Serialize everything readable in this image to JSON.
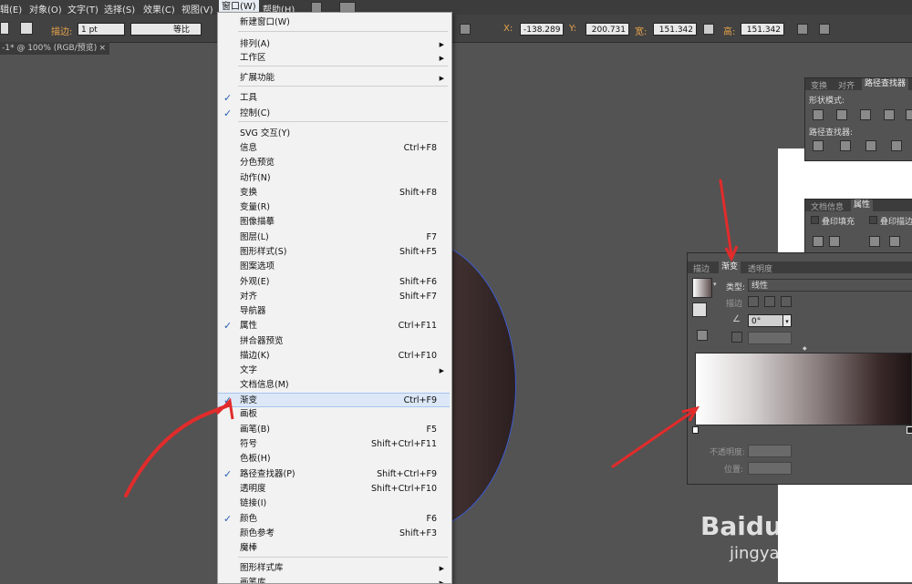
{
  "menubar": {
    "items": [
      "辑(E)",
      "对象(O)",
      "文字(T)",
      "选择(S)",
      "效果(C)",
      "视图(V)",
      "窗口(W)",
      "帮助(H)"
    ]
  },
  "controlbar": {
    "stroke_label": "描边:",
    "stroke_value": "1 pt",
    "profile_label": "等比",
    "x_label": "X:",
    "x_value": "-138.289",
    "y_label": "Y:",
    "y_value": "200.731",
    "w_label": "宽:",
    "w_value": "151.342",
    "h_label": "高:",
    "h_value": "151.342"
  },
  "doc_tab": {
    "title": "-1* @ 100% (RGB/预览)",
    "close": "×"
  },
  "window_menu": {
    "items": [
      {
        "label": "新建窗口(W)",
        "shortcut": "",
        "checked": false,
        "sub": false
      },
      {
        "label": "排列(A)",
        "shortcut": "",
        "checked": false,
        "sub": true
      },
      {
        "label": "工作区",
        "shortcut": "",
        "checked": false,
        "sub": true
      },
      {
        "label": "扩展功能",
        "shortcut": "",
        "checked": false,
        "sub": true
      },
      {
        "label": "工具",
        "shortcut": "",
        "checked": true,
        "sub": false
      },
      {
        "label": "控制(C)",
        "shortcut": "",
        "checked": true,
        "sub": false
      },
      {
        "label": "SVG 交互(Y)",
        "shortcut": "",
        "checked": false,
        "sub": false
      },
      {
        "label": "信息",
        "shortcut": "Ctrl+F8",
        "checked": false,
        "sub": false
      },
      {
        "label": "分色预览",
        "shortcut": "",
        "checked": false,
        "sub": false
      },
      {
        "label": "动作(N)",
        "shortcut": "",
        "checked": false,
        "sub": false
      },
      {
        "label": "变换",
        "shortcut": "Shift+F8",
        "checked": false,
        "sub": false
      },
      {
        "label": "变量(R)",
        "shortcut": "",
        "checked": false,
        "sub": false
      },
      {
        "label": "图像描摹",
        "shortcut": "",
        "checked": false,
        "sub": false
      },
      {
        "label": "图层(L)",
        "shortcut": "F7",
        "checked": false,
        "sub": false
      },
      {
        "label": "图形样式(S)",
        "shortcut": "Shift+F5",
        "checked": false,
        "sub": false
      },
      {
        "label": "图案选项",
        "shortcut": "",
        "checked": false,
        "sub": false
      },
      {
        "label": "外观(E)",
        "shortcut": "Shift+F6",
        "checked": false,
        "sub": false
      },
      {
        "label": "对齐",
        "shortcut": "Shift+F7",
        "checked": false,
        "sub": false
      },
      {
        "label": "导航器",
        "shortcut": "",
        "checked": false,
        "sub": false
      },
      {
        "label": "属性",
        "shortcut": "Ctrl+F11",
        "checked": true,
        "sub": false
      },
      {
        "label": "拼合器预览",
        "shortcut": "",
        "checked": false,
        "sub": false
      },
      {
        "label": "描边(K)",
        "shortcut": "Ctrl+F10",
        "checked": false,
        "sub": false
      },
      {
        "label": "文字",
        "shortcut": "",
        "checked": false,
        "sub": true
      },
      {
        "label": "文档信息(M)",
        "shortcut": "",
        "checked": false,
        "sub": false
      },
      {
        "label": "渐变",
        "shortcut": "Ctrl+F9",
        "checked": true,
        "sub": false
      },
      {
        "label": "画板",
        "shortcut": "",
        "checked": false,
        "sub": false
      },
      {
        "label": "画笔(B)",
        "shortcut": "F5",
        "checked": false,
        "sub": false
      },
      {
        "label": "符号",
        "shortcut": "Shift+Ctrl+F11",
        "checked": false,
        "sub": false
      },
      {
        "label": "色板(H)",
        "shortcut": "",
        "checked": false,
        "sub": false
      },
      {
        "label": "路径查找器(P)",
        "shortcut": "Shift+Ctrl+F9",
        "checked": true,
        "sub": false
      },
      {
        "label": "透明度",
        "shortcut": "Shift+Ctrl+F10",
        "checked": false,
        "sub": false
      },
      {
        "label": "链接(I)",
        "shortcut": "",
        "checked": false,
        "sub": false
      },
      {
        "label": "颜色",
        "shortcut": "F6",
        "checked": true,
        "sub": false
      },
      {
        "label": "颜色参考",
        "shortcut": "Shift+F3",
        "checked": false,
        "sub": false
      },
      {
        "label": "魔棒",
        "shortcut": "",
        "checked": false,
        "sub": false
      },
      {
        "label": "图形样式库",
        "shortcut": "",
        "checked": false,
        "sub": true
      },
      {
        "label": "画笔库",
        "shortcut": "",
        "checked": false,
        "sub": true
      }
    ]
  },
  "pathfinder_panel": {
    "tabs": [
      "变换",
      "对齐",
      "路径查找器"
    ],
    "shape_modes": "形状模式:",
    "pathfinders": "路径查找器:"
  },
  "attributes_panel": {
    "tabs": [
      "文档信息",
      "属性"
    ],
    "overprint_fill": "叠印填充",
    "overprint_stroke": "叠印描边"
  },
  "gradient_panel": {
    "tabs": [
      "描边",
      "渐变",
      "透明度"
    ],
    "type_label": "类型:",
    "type_value": "线性",
    "stroke_label": "描边",
    "angle_value": "0°",
    "opacity_label": "不透明度:",
    "location_label": "位置:"
  },
  "watermark": {
    "brand": "Baidu经验",
    "url": "jingyan.baidu.com"
  }
}
